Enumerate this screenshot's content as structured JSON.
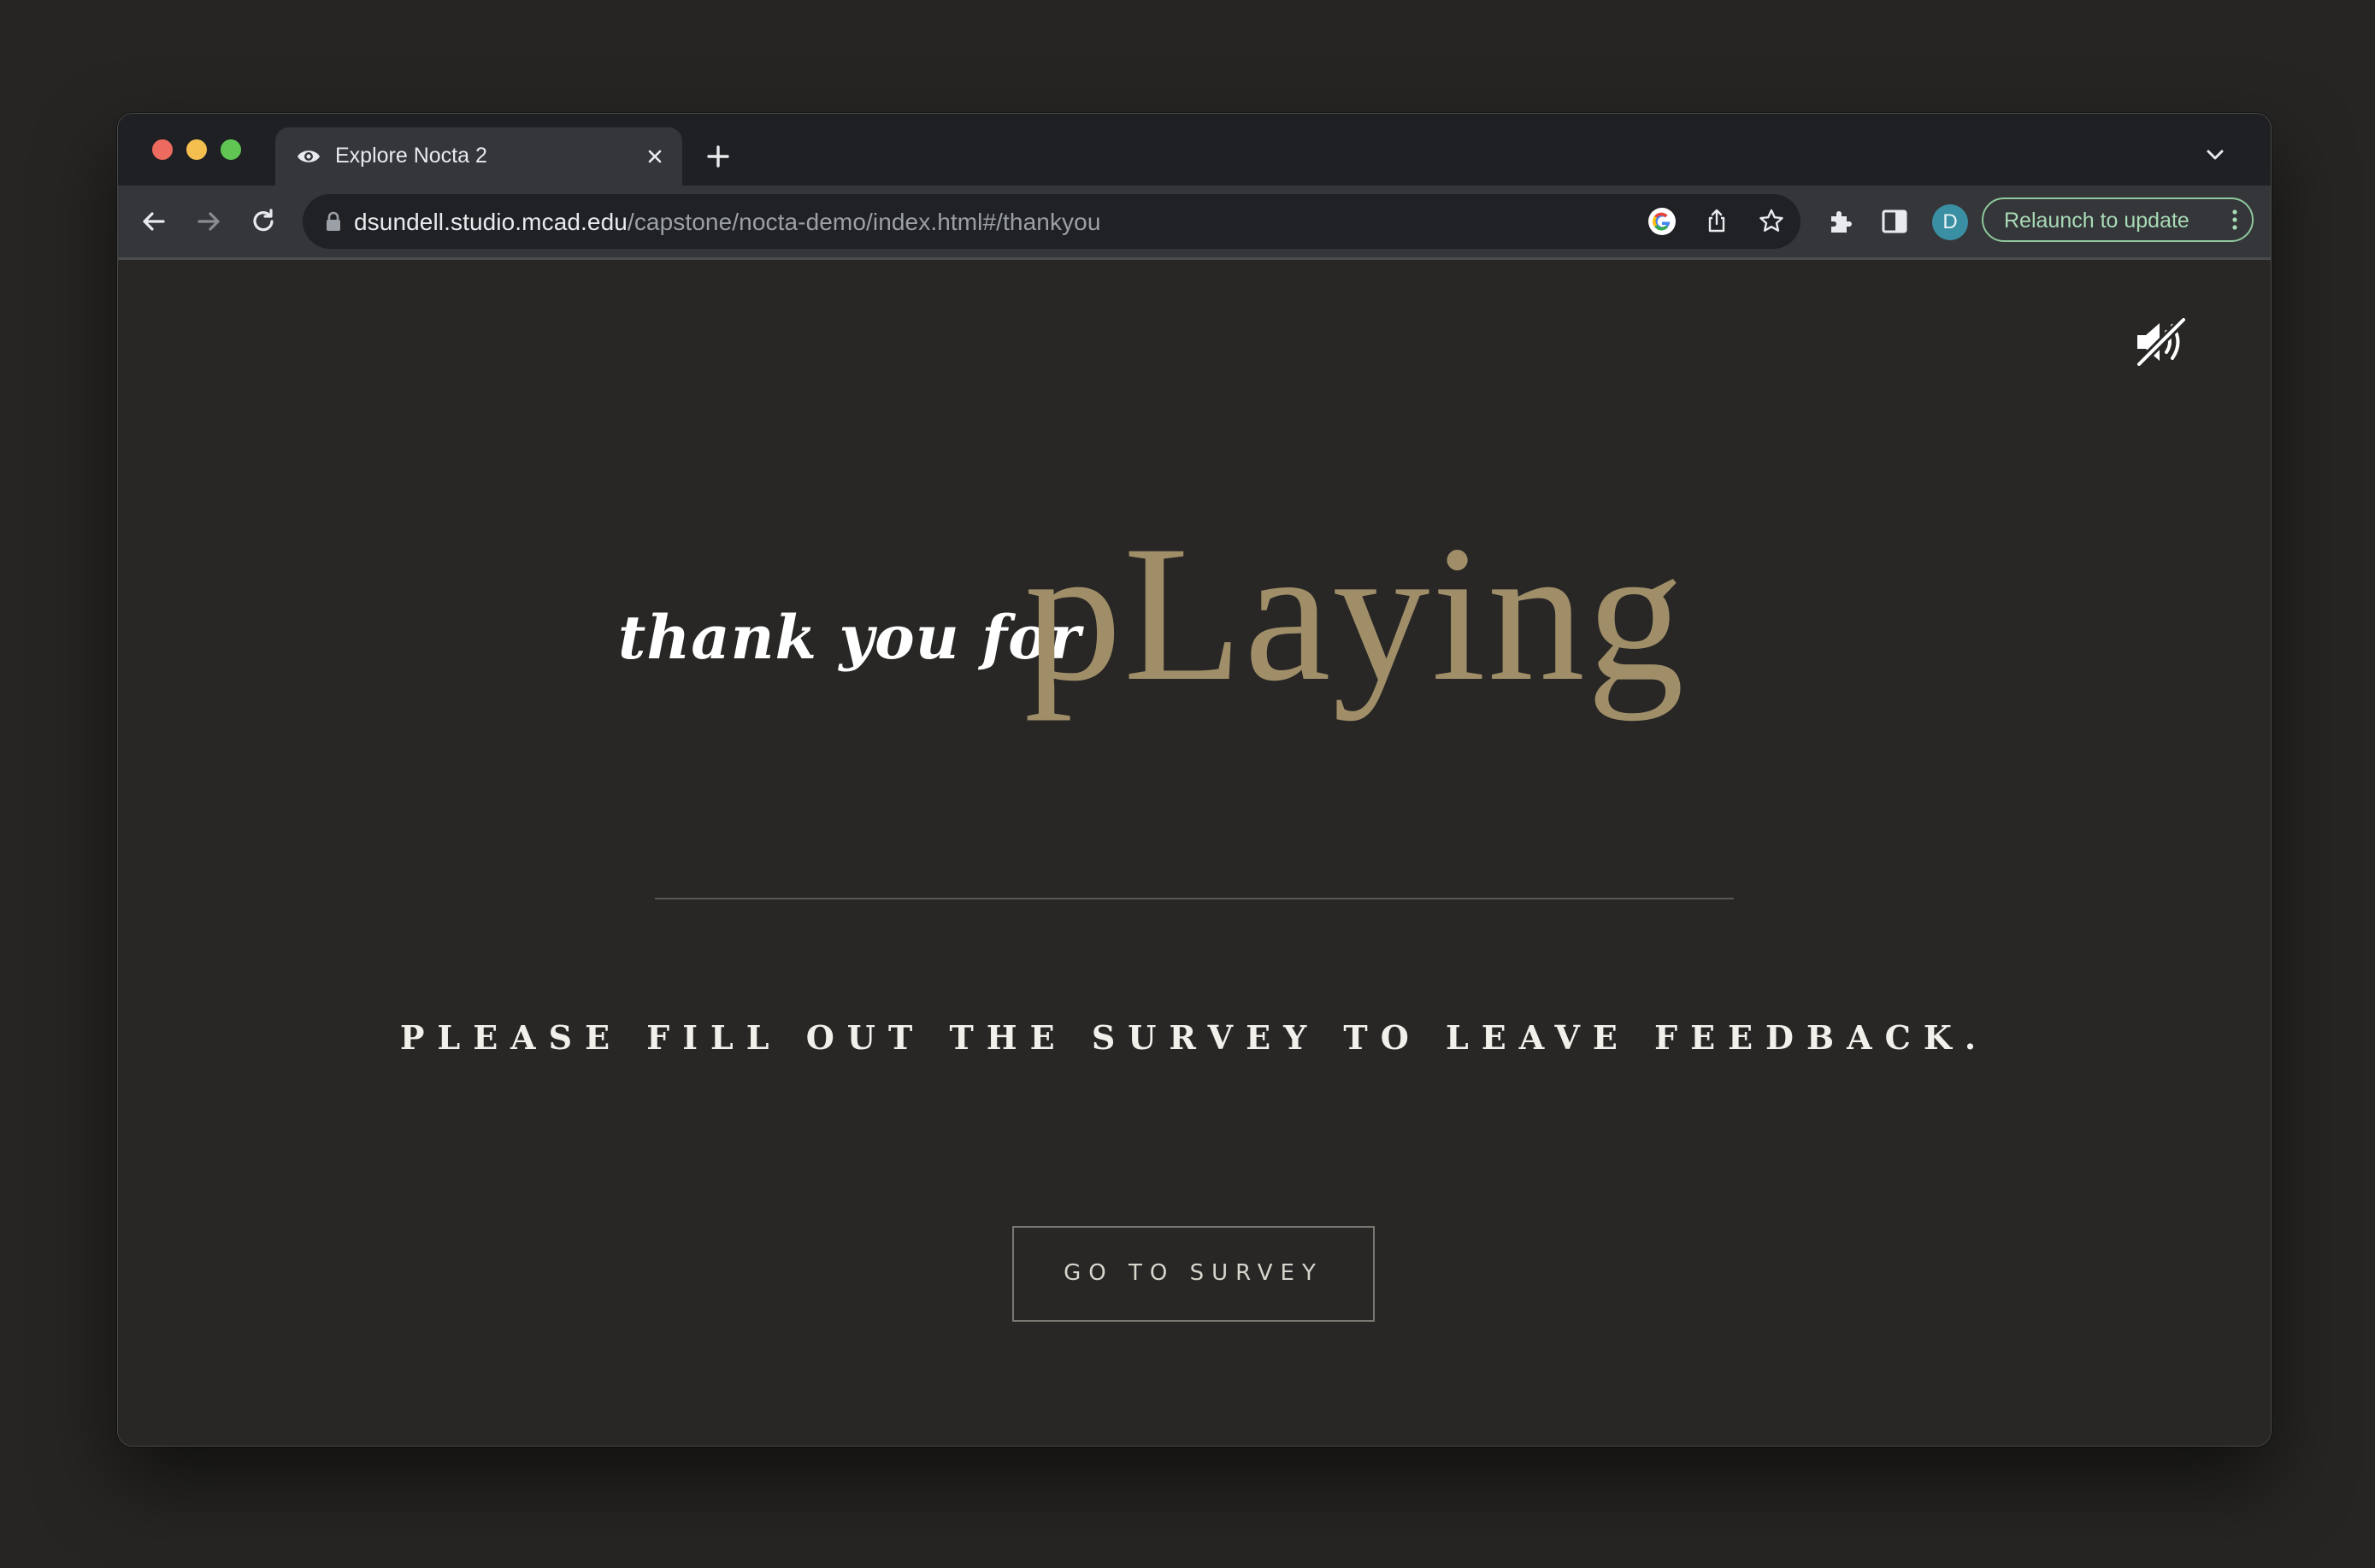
{
  "tab": {
    "title": "Explore Nocta 2",
    "icon": "eye-icon"
  },
  "omnibox": {
    "host": "dsundell.studio.mcad.edu",
    "path": "/capstone/nocta-demo/index.html#/thankyou"
  },
  "profile": {
    "initial": "D"
  },
  "relaunch": {
    "label": "Relaunch to update"
  },
  "page": {
    "thank_text": "thank you for",
    "playing_text": "pLaying",
    "survey_message": "PLEASE FILL OUT THE SURVEY TO LEAVE FEEDBACK.",
    "survey_button": "GO TO SURVEY",
    "mute_icon": "mute-icon"
  },
  "colors": {
    "accent_gold": "#a08e69",
    "page_background": "#282725",
    "relaunch_green": "#a8dab5",
    "avatar_teal": "#3b8fa3"
  }
}
